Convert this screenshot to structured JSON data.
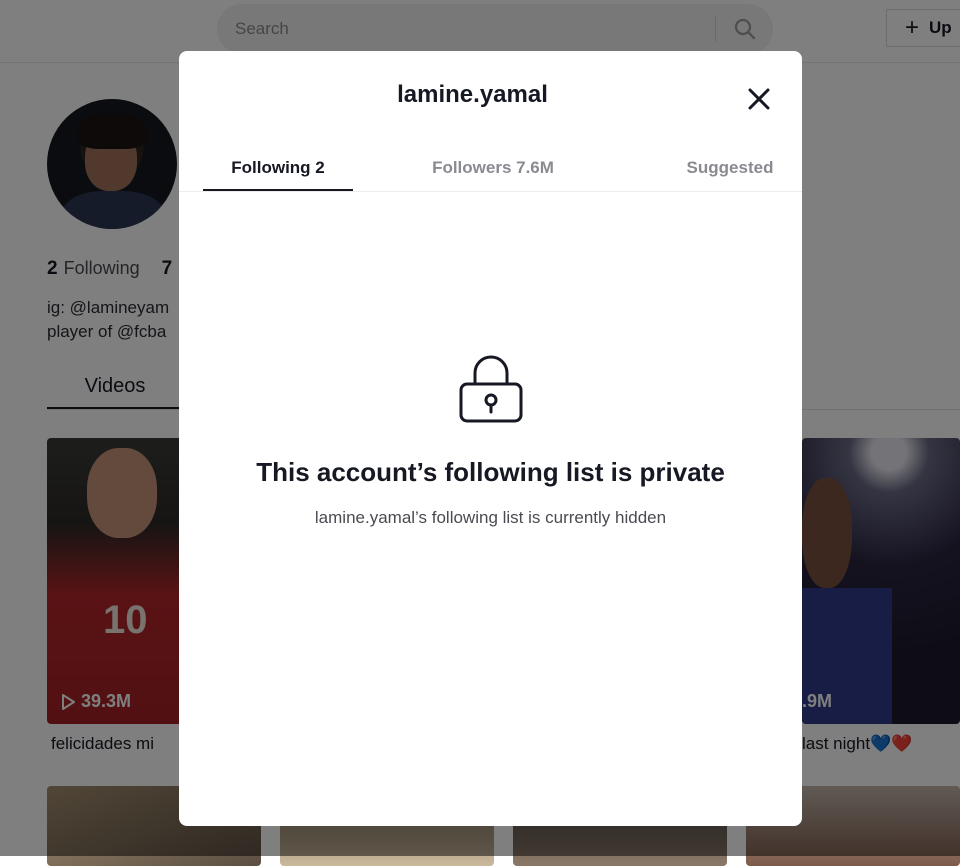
{
  "header": {
    "search_placeholder": "Search",
    "upload_label": "Up"
  },
  "profile": {
    "following_count": "2",
    "following_label": "Following",
    "followers_count_partial": "7",
    "bio_line1": "ig: @lamineyam",
    "bio_line2": "player of @fcba",
    "videos_tab": "Videos"
  },
  "videos": [
    {
      "views": "39.3M",
      "caption": "felicidades mi"
    },
    {
      "views": ".9M",
      "caption": "last night💙❤️"
    }
  ],
  "modal": {
    "title": "lamine.yamal",
    "tabs": [
      {
        "label": "Following 2",
        "active": true
      },
      {
        "label": "Followers 7.6M",
        "active": false
      },
      {
        "label": "Suggested",
        "active": false
      }
    ],
    "empty_title": "This account’s following list is private",
    "empty_subtitle": "lamine.yamal’s following list is currently hidden",
    "icons": {
      "close": "close-icon",
      "lock": "lock-icon"
    }
  },
  "colors": {
    "text_primary": "#161823",
    "text_secondary": "#8a8b91",
    "overlay": "rgba(0,0,0,0.5)"
  }
}
